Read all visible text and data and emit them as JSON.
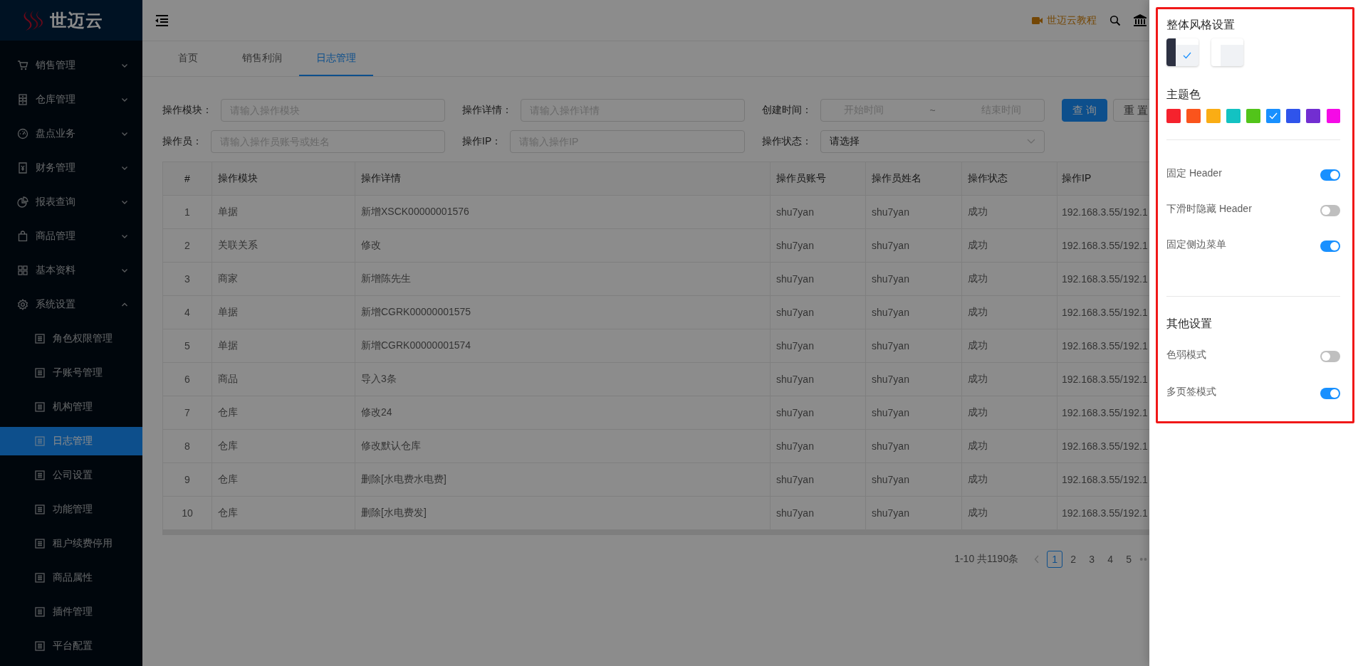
{
  "sidebar": {
    "logo": "世迈云",
    "items": [
      {
        "label": "销售管理",
        "expanded": false
      },
      {
        "label": "仓库管理",
        "expanded": false
      },
      {
        "label": "盘点业务",
        "expanded": false
      },
      {
        "label": "财务管理",
        "expanded": false
      },
      {
        "label": "报表查询",
        "expanded": false
      },
      {
        "label": "商品管理",
        "expanded": false
      },
      {
        "label": "基本资料",
        "expanded": false
      },
      {
        "label": "系统设置",
        "expanded": true,
        "children": [
          {
            "label": "角色权限管理",
            "selected": false
          },
          {
            "label": "子账号管理",
            "selected": false
          },
          {
            "label": "机构管理",
            "selected": false
          },
          {
            "label": "日志管理",
            "selected": true
          },
          {
            "label": "公司设置",
            "selected": false
          },
          {
            "label": "功能管理",
            "selected": false
          },
          {
            "label": "租户续费停用",
            "selected": false
          },
          {
            "label": "商品属性",
            "selected": false
          },
          {
            "label": "插件管理",
            "selected": false
          },
          {
            "label": "平台配置",
            "selected": false
          }
        ]
      }
    ]
  },
  "header": {
    "tutorial_link": "世迈云教程"
  },
  "tabs": [
    {
      "label": "首页",
      "selected": false
    },
    {
      "label": "销售利润",
      "selected": false
    },
    {
      "label": "日志管理",
      "selected": true
    }
  ],
  "filters": [
    {
      "kind": "input",
      "label": "操作模块：",
      "placeholder": "请输入操作模块"
    },
    {
      "kind": "input",
      "label": "操作详情：",
      "placeholder": "请输入操作详情"
    },
    {
      "kind": "range",
      "label": "创建时间：",
      "placeholder_start": "开始时间",
      "separator": "~",
      "placeholder_end": "结束时间"
    },
    {
      "kind": "input",
      "label": "操作员：",
      "placeholder": "请输入操作员账号或姓名"
    },
    {
      "kind": "input",
      "label": "操作IP：",
      "placeholder": "请输入操作IP"
    },
    {
      "kind": "select",
      "label": "操作状态：",
      "value": "请选择"
    }
  ],
  "buttons": [
    {
      "kind": "primary",
      "label": "查 询"
    },
    {
      "kind": "default",
      "label": "重 置"
    }
  ],
  "table": {
    "columns": [
      "#",
      "操作模块",
      "操作详情",
      "操作员账号",
      "操作员姓名",
      "操作状态",
      "操作IP"
    ],
    "rows": [
      [
        "1",
        "单据",
        "新增XSCK00000001576",
        "shu7yan",
        "shu7yan",
        "成功",
        "192.168.3.55/192.1"
      ],
      [
        "2",
        "关联关系",
        "修改",
        "shu7yan",
        "shu7yan",
        "成功",
        "192.168.3.55/192.1"
      ],
      [
        "3",
        "商家",
        "新增陈先生",
        "shu7yan",
        "shu7yan",
        "成功",
        "192.168.3.55/192.1"
      ],
      [
        "4",
        "单据",
        "新增CGRK00000001575",
        "shu7yan",
        "shu7yan",
        "成功",
        "192.168.3.55/192.1"
      ],
      [
        "5",
        "单据",
        "新增CGRK00000001574",
        "shu7yan",
        "shu7yan",
        "成功",
        "192.168.3.55/192.1"
      ],
      [
        "6",
        "商品",
        "导入3条",
        "shu7yan",
        "shu7yan",
        "成功",
        "192.168.3.55/192.1"
      ],
      [
        "7",
        "仓库",
        "修改24",
        "shu7yan",
        "shu7yan",
        "成功",
        "192.168.3.55/192.1"
      ],
      [
        "8",
        "仓库",
        "修改默认仓库",
        "shu7yan",
        "shu7yan",
        "成功",
        "192.168.3.55/192.1"
      ],
      [
        "9",
        "仓库",
        "删除[水电费水电费]",
        "shu7yan",
        "shu7yan",
        "成功",
        "192.168.3.55/192.1"
      ],
      [
        "10",
        "仓库",
        "删除[水电费发]",
        "shu7yan",
        "shu7yan",
        "成功",
        "192.168.3.55/192.1"
      ]
    ]
  },
  "pagination": {
    "total": "1-10 共1190条",
    "pages": [
      {
        "label": "1",
        "selected": true
      },
      {
        "label": "2",
        "selected": false
      },
      {
        "label": "3",
        "selected": false
      },
      {
        "label": "4",
        "selected": false
      },
      {
        "label": "5",
        "selected": false
      }
    ],
    "more": "••"
  },
  "settings_drawer": {
    "style_title": "整体风格设置",
    "styles": [
      {
        "kind": "dark",
        "selected": true
      },
      {
        "kind": "light",
        "selected": false
      }
    ],
    "theme_title": "主题色",
    "theme_colors": [
      {
        "color": "#f5222d",
        "selected": false
      },
      {
        "color": "#fa541c",
        "selected": false
      },
      {
        "color": "#faad14",
        "selected": false
      },
      {
        "color": "#13c2c2",
        "selected": false
      },
      {
        "color": "#52c41a",
        "selected": false
      },
      {
        "color": "#1890ff",
        "selected": true
      },
      {
        "color": "#2f54eb",
        "selected": false
      },
      {
        "color": "#722ed1",
        "selected": false
      },
      {
        "color": "#f50ae6",
        "selected": false
      }
    ],
    "layout_toggles": [
      {
        "label": "固定 Header",
        "on": true
      },
      {
        "label": "下滑时隐藏 Header",
        "on": false
      },
      {
        "label": "固定侧边菜单",
        "on": true
      }
    ],
    "other_title": "其他设置",
    "other_toggles": [
      {
        "label": "色弱模式",
        "on": false
      },
      {
        "label": "多页签模式",
        "on": true
      }
    ]
  }
}
